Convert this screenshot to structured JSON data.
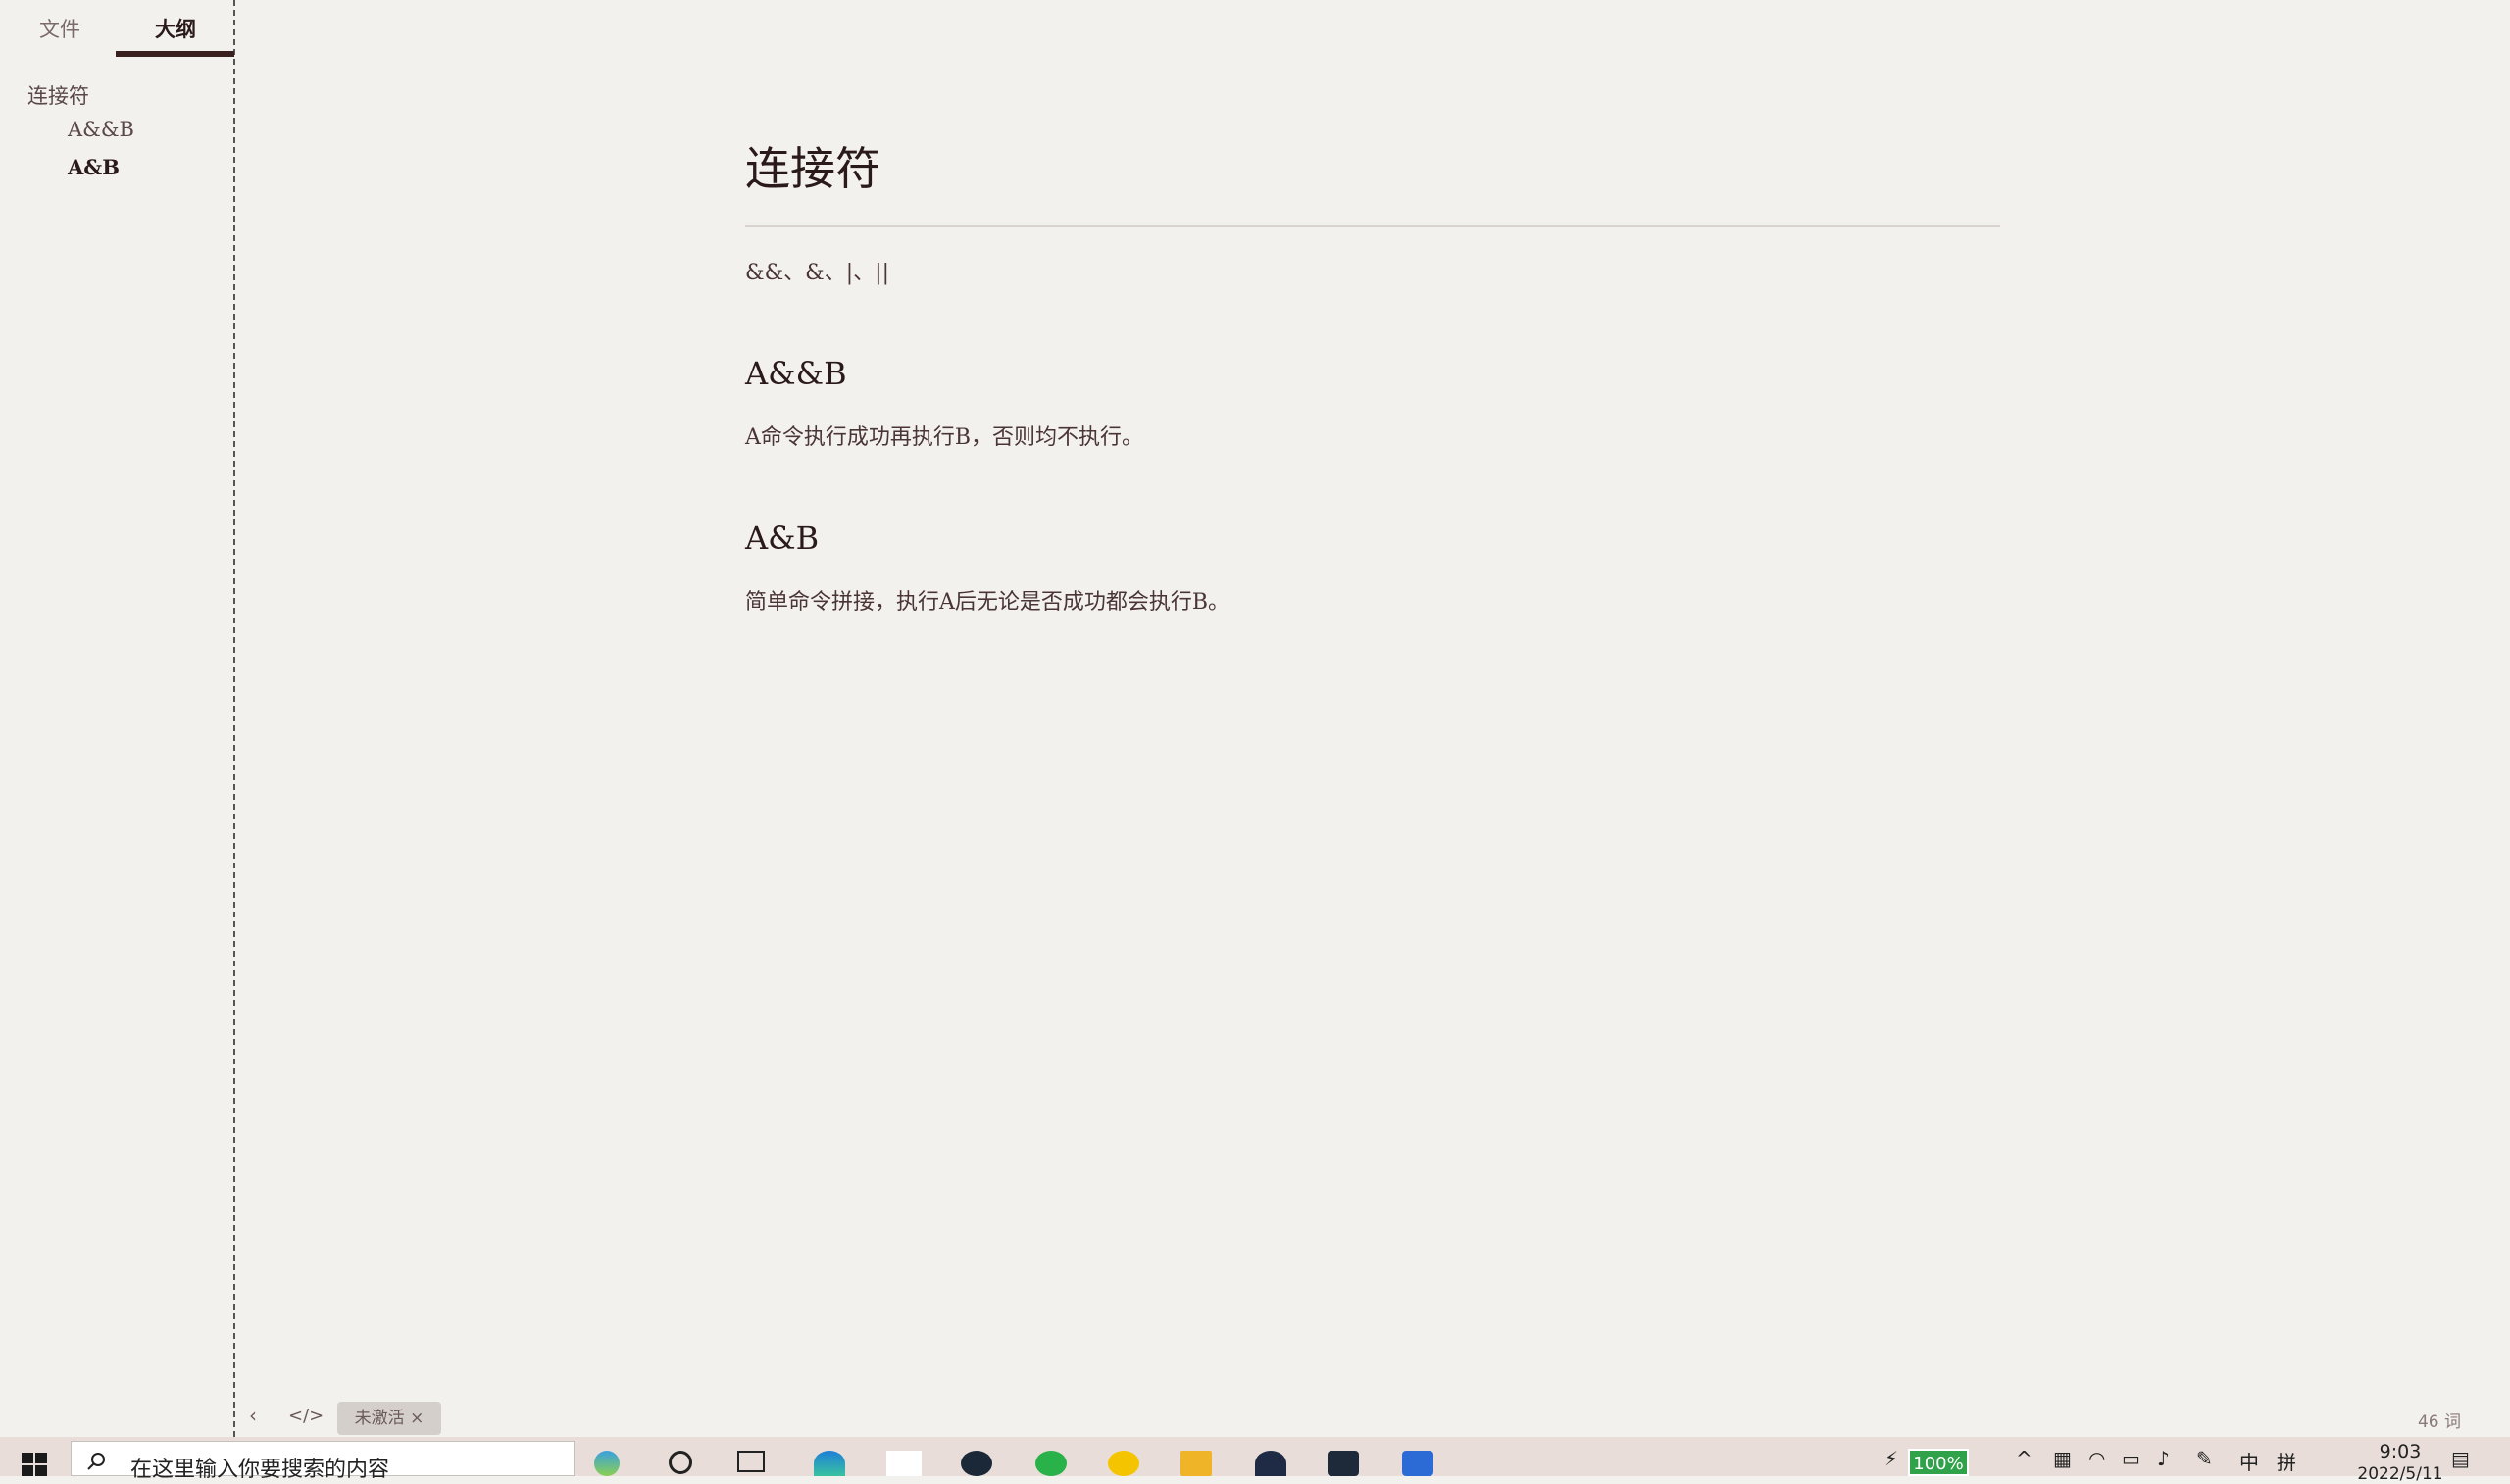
{
  "sidebar": {
    "tabs": [
      {
        "label": "文件"
      },
      {
        "label": "大纲"
      }
    ],
    "outline": [
      {
        "label": "连接符"
      },
      {
        "label": "A&&B"
      },
      {
        "label": "A&B"
      }
    ]
  },
  "document": {
    "title": "连接符",
    "intro": "&&、&、|、||",
    "sections": [
      {
        "heading": "A&&B",
        "body": "A命令执行成功再执行B，否则均不执行。"
      },
      {
        "heading": "A&B",
        "body": "简单命令拼接，执行A后无论是否成功都会执行B。"
      }
    ]
  },
  "statusbar": {
    "back_icon": "‹",
    "code_icon": "</>",
    "badge": "未激活 ×",
    "word_count": "46 词"
  },
  "taskbar": {
    "search_placeholder": "在这里输入你要搜索的内容",
    "battery": "100%",
    "ime": "中",
    "ime2": "拼",
    "time": "9:03",
    "date": "2022/5/11"
  },
  "colors": {
    "background": "#f3f1ee",
    "text": "#3a2626",
    "taskbar": "#e8ddd8",
    "battery": "#2fa24a"
  }
}
